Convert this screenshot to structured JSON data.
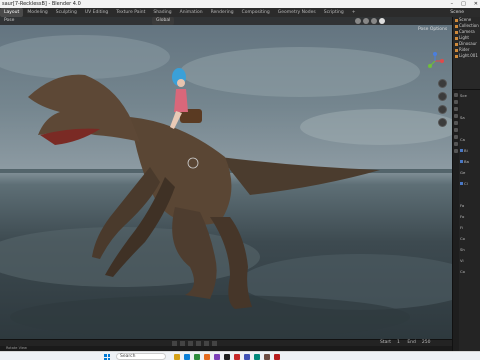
{
  "titlebar": {
    "title": "saur[7-RecklessB] - Blender 4.0",
    "min": "–",
    "max": "□",
    "close": "✕"
  },
  "topbar": {
    "workspaces": [
      "Layout",
      "Modeling",
      "Sculpting",
      "UV Editing",
      "Texture Paint",
      "Shading",
      "Animation",
      "Rendering",
      "Compositing",
      "Geometry Nodes",
      "Scripting",
      "+"
    ],
    "active": "Layout",
    "scene_label": "Scene"
  },
  "viewport": {
    "mode": "Pose",
    "orientation": "Global",
    "options": "Pose Options"
  },
  "outliner": {
    "rows": [
      "Scene",
      "Collection",
      "Camera",
      "Light",
      "Dinosaur",
      "Rider",
      "Light.001"
    ]
  },
  "properties": {
    "rows": [
      "Sce",
      "",
      "Sa",
      "",
      "Ca",
      "Bi",
      "Ba",
      "Ge",
      "Cl",
      "",
      "Fa",
      "Fo",
      "Fi",
      "Co",
      "Sh",
      "Vi",
      "Co"
    ]
  },
  "timeline": {
    "start_label": "Start",
    "start_value": "1",
    "end_label": "End",
    "end_value": "250"
  },
  "statusbar": {
    "text": "Rotate View"
  },
  "taskbar": {
    "search_placeholder": "Search"
  },
  "colors": {
    "accent": "#4a78c4",
    "sky": "#75868f",
    "sea": "#3d4a50"
  }
}
